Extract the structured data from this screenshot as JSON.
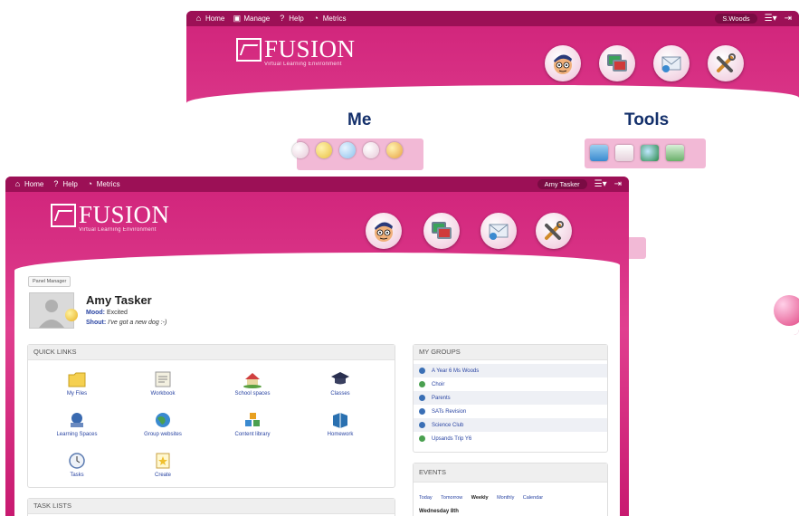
{
  "back_window": {
    "topbar": {
      "items": [
        {
          "label": "Home",
          "icon": "home-icon"
        },
        {
          "label": "Manage",
          "icon": "manage-icon"
        },
        {
          "label": "Help",
          "icon": "help-icon"
        },
        {
          "label": "Metrics",
          "icon": "metrics-icon"
        }
      ],
      "user": "S.Woods"
    },
    "logo": {
      "name": "FUSION",
      "subtitle": "Virtual Learning Environment"
    },
    "sections": {
      "me": "Me",
      "tools": "Tools"
    }
  },
  "front_window": {
    "topbar": {
      "items": [
        {
          "label": "Home",
          "icon": "home-icon"
        },
        {
          "label": "Help",
          "icon": "help-icon"
        },
        {
          "label": "Metrics",
          "icon": "metrics-icon"
        }
      ],
      "user": "Amy Tasker"
    },
    "logo": {
      "name": "FUSION",
      "subtitle": "Virtual Learning Environment"
    },
    "panel_manager": "Panel Manager",
    "profile": {
      "name": "Amy Tasker",
      "mood_label": "Mood:",
      "mood_value": "Excited",
      "shout_label": "Shout:",
      "shout_value": "I've got a new dog :-)"
    },
    "quick_links": {
      "title": "QUICK LINKS",
      "items": [
        {
          "label": "My Files",
          "icon": "folder-icon"
        },
        {
          "label": "Workbook",
          "icon": "workbook-icon"
        },
        {
          "label": "School spaces",
          "icon": "school-icon"
        },
        {
          "label": "Classes",
          "icon": "graduation-cap-icon"
        },
        {
          "label": "Learning Spaces",
          "icon": "learning-space-icon"
        },
        {
          "label": "Group websites",
          "icon": "globe-icon"
        },
        {
          "label": "Content library",
          "icon": "blocks-icon"
        },
        {
          "label": "Homework",
          "icon": "book-icon"
        },
        {
          "label": "Tasks",
          "icon": "clock-icon"
        },
        {
          "label": "Create",
          "icon": "create-icon"
        }
      ]
    },
    "task_lists": {
      "title": "TASK LISTS"
    },
    "my_groups": {
      "title": "MY GROUPS",
      "items": [
        "A Year 6 Ms Woods",
        "Choir",
        "Parents",
        "SATs Revision",
        "Science Club",
        "Upsands Trip Y6"
      ]
    },
    "events": {
      "title": "EVENTS",
      "tabs": [
        "Today",
        "Tomorrow",
        "Weekly",
        "Monthly",
        "Calendar"
      ],
      "active_tab": "Weekly",
      "day": "Wednesday 8th"
    }
  },
  "colors": {
    "pink": "#d0237a",
    "dark_pink": "#9c1056",
    "link_blue": "#2a45a3",
    "heading_navy": "#14306b"
  }
}
